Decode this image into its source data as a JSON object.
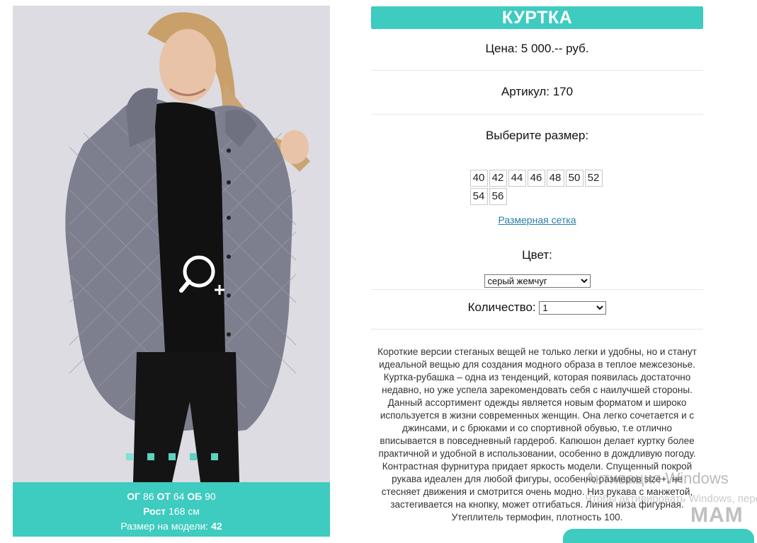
{
  "product": {
    "title": "КУРТКА",
    "price_text": "Цена: 5 000.-- руб.",
    "sku_text": "Артикул: 170"
  },
  "gallery": {
    "image_description": "Woman in a grey quilted hooded jacket and black outfit",
    "dots_count": 5,
    "active_dot": 0
  },
  "model_info": {
    "og_label": "ОГ",
    "og_value": "86",
    "ot_label": "ОТ",
    "ot_value": "64",
    "ob_label": "ОБ",
    "ob_value": "90",
    "height_label": "Рост",
    "height_value": "168 см",
    "size_label": "Размер на модели:",
    "size_value": "42"
  },
  "size_selector": {
    "label": "Выберите размер:",
    "sizes": [
      "40",
      "42",
      "44",
      "46",
      "48",
      "50",
      "52",
      "54",
      "56"
    ],
    "chart_link": "Размерная сетка"
  },
  "color_selector": {
    "label": "Цвет:",
    "selected": "серый жемчуг"
  },
  "quantity": {
    "label": "Количество:",
    "selected": "1"
  },
  "description": "Короткие версии стеганых вещей не только легки и удобны, но и станут идеальной вещью для создания модного образа в теплое межсезонье. Куртка-рубашка – одна из тенденций, которая появилась достаточно недавно, но уже успела зарекомендовать себя с наилучшей стороны. Данный ассортимент одежды является новым форматом и широко используется в жизни современных женщин. Она легко сочетается и с джинсами, и с брюками и со спортивной обувью, т.е отлично вписывается в повседневный гардероб. Капюшон делает куртку более практичной и удобной в использовании, особенно в дождливую погоду. Контрастная фурнитура придает яркость модели. Спущенный покрой рукава идеален для любой фигуры, особенно размеров size+, не стесняет движения и смотрится очень модно. Низ рукава с манжетой, застегивается на кнопку, может отгибаться. Линия низа фигурная. Утеплитель термофин, плотность 100.",
  "overlay": {
    "watermark_title": "Активация Windows",
    "watermark_sub": "Чтобы активировать Windows, перейдите в раздел \"Параметры\".",
    "logo_text": "МАМ"
  },
  "colors": {
    "accent": "#3ecbc0",
    "link": "#2a7fa8",
    "photo_bg": "#dcdce2"
  }
}
